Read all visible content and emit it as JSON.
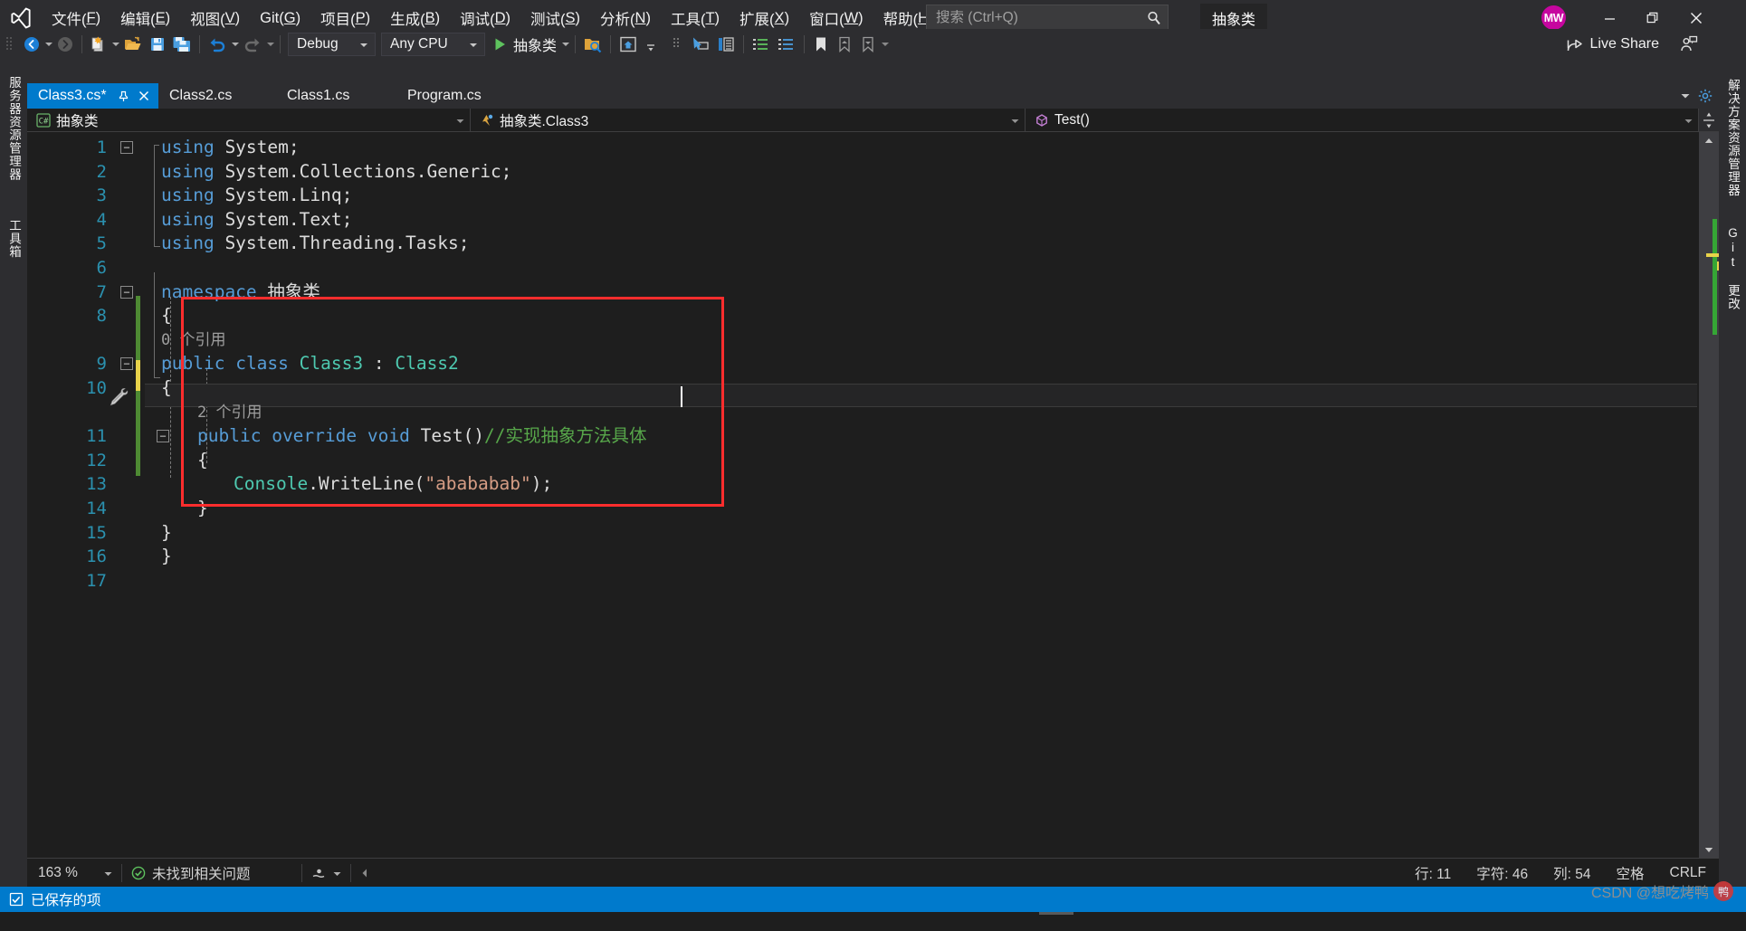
{
  "app": {
    "logo_icon": "visual-studio-logo",
    "solution_name": "抽象类"
  },
  "menubar": {
    "items": [
      {
        "label": "文件(F)",
        "name": "file"
      },
      {
        "label": "编辑(E)",
        "name": "edit"
      },
      {
        "label": "视图(V)",
        "name": "view"
      },
      {
        "label": "Git(G)",
        "name": "git"
      },
      {
        "label": "项目(P)",
        "name": "project"
      },
      {
        "label": "生成(B)",
        "name": "build"
      },
      {
        "label": "调试(D)",
        "name": "debug"
      },
      {
        "label": "测试(S)",
        "name": "test"
      },
      {
        "label": "分析(N)",
        "name": "analyze"
      },
      {
        "label": "工具(T)",
        "name": "tools"
      },
      {
        "label": "扩展(X)",
        "name": "extensions"
      },
      {
        "label": "窗口(W)",
        "name": "window"
      },
      {
        "label": "帮助(H)",
        "name": "help"
      }
    ]
  },
  "search": {
    "placeholder": "搜索 (Ctrl+Q)",
    "value": "",
    "icon": "search-icon"
  },
  "account": {
    "initials": "MW",
    "color": "#c6069f"
  },
  "window_controls": {
    "minimize": "minimize-icon",
    "maximize": "restore-icon",
    "close": "close-icon"
  },
  "toolbar": {
    "nav_back": "back-arrow-icon",
    "nav_forward": "forward-arrow-icon",
    "new_item": "new-file-icon",
    "open": "open-folder-icon",
    "save": "save-icon",
    "save_all": "save-all-icon",
    "undo": "undo-icon",
    "redo": "redo-icon",
    "config_label": "Debug",
    "platform_label": "Any CPU",
    "run_label": "抽象类",
    "run_icon": "play-icon",
    "search_solution_icon": "search-folder-icon",
    "live_share_label": "Live Share",
    "live_share_icon": "live-share-icon",
    "feedback_icon": "feedback-person-icon"
  },
  "left_dock": {
    "items": [
      {
        "label": "服务器资源管理器",
        "name": "server-explorer"
      },
      {
        "label": "工具箱",
        "name": "toolbox"
      }
    ]
  },
  "right_dock": {
    "items": [
      {
        "label": "解决方案资源管理器",
        "name": "solution-explorer"
      },
      {
        "label": "Git 更改",
        "name": "git-changes"
      }
    ]
  },
  "tabs": [
    {
      "label": "Class3.cs*",
      "active": true,
      "name": "class3"
    },
    {
      "label": "Class2.cs",
      "active": false,
      "name": "class2"
    },
    {
      "label": "Class1.cs",
      "active": false,
      "name": "class1"
    },
    {
      "label": "Program.cs",
      "active": false,
      "name": "program"
    }
  ],
  "tab_controls": {
    "pin_icon": "pin-icon",
    "close_icon": "close-icon",
    "dropdown_icon": "chevron-down-icon",
    "settings_icon": "gear-icon"
  },
  "breadcrumb": {
    "project": "抽象类",
    "project_icon": "csharp-file-icon",
    "type": "抽象类.Class3",
    "type_icon": "class-icon",
    "member": "Test()",
    "member_icon": "method-icon",
    "split_icon": "split-view-icon"
  },
  "code": {
    "lines": [
      {
        "n": "1",
        "indent": 0,
        "fold": "minus",
        "tokens": [
          {
            "t": "using",
            "c": "kw"
          },
          {
            "t": " System;",
            "c": "pln"
          }
        ]
      },
      {
        "n": "2",
        "indent": 0,
        "tokens": [
          {
            "t": "using",
            "c": "kw"
          },
          {
            "t": " System.Collections.Generic;",
            "c": "pln"
          }
        ]
      },
      {
        "n": "3",
        "indent": 0,
        "tokens": [
          {
            "t": "using",
            "c": "kw"
          },
          {
            "t": " System.Linq;",
            "c": "pln"
          }
        ]
      },
      {
        "n": "4",
        "indent": 0,
        "tokens": [
          {
            "t": "using",
            "c": "kw"
          },
          {
            "t": " System.Text;",
            "c": "pln"
          }
        ]
      },
      {
        "n": "5",
        "indent": 0,
        "tokens": [
          {
            "t": "using",
            "c": "kw"
          },
          {
            "t": " System.Threading.Tasks;",
            "c": "pln"
          }
        ]
      },
      {
        "n": "6",
        "indent": 0,
        "tokens": []
      },
      {
        "n": "7",
        "indent": 0,
        "fold": "minus",
        "tokens": [
          {
            "t": "namespace",
            "c": "kw"
          },
          {
            "t": " 抽象类",
            "c": "pln"
          }
        ]
      },
      {
        "n": "8",
        "indent": 0,
        "tokens": [
          {
            "t": "{",
            "c": "pln"
          }
        ]
      },
      {
        "n": "",
        "indent": 0,
        "reference": "0 个引用"
      },
      {
        "n": "9",
        "indent": 0,
        "fold": "minus",
        "tokens": [
          {
            "t": "public",
            "c": "kw"
          },
          {
            "t": " ",
            "c": "pln"
          },
          {
            "t": "class",
            "c": "kw"
          },
          {
            "t": " ",
            "c": "pln"
          },
          {
            "t": "Class3",
            "c": "type"
          },
          {
            "t": " : ",
            "c": "pln"
          },
          {
            "t": "Class2",
            "c": "type"
          }
        ]
      },
      {
        "n": "10",
        "indent": 0,
        "tokens": [
          {
            "t": "{",
            "c": "pln"
          }
        ]
      },
      {
        "n": "",
        "indent": 1,
        "reference": "2 个引用"
      },
      {
        "n": "11",
        "indent": 1,
        "fold": "minus",
        "current": true,
        "tokens": [
          {
            "t": "public",
            "c": "kw"
          },
          {
            "t": " ",
            "c": "pln"
          },
          {
            "t": "override",
            "c": "kw"
          },
          {
            "t": " ",
            "c": "pln"
          },
          {
            "t": "void",
            "c": "kw"
          },
          {
            "t": " ",
            "c": "pln"
          },
          {
            "t": "Test",
            "c": "mth"
          },
          {
            "t": "()",
            "c": "pln"
          },
          {
            "t": "//实现抽象方法具体",
            "c": "cmt"
          }
        ]
      },
      {
        "n": "12",
        "indent": 1,
        "tokens": [
          {
            "t": "{",
            "c": "pln"
          }
        ]
      },
      {
        "n": "13",
        "indent": 2,
        "tokens": [
          {
            "t": "Console",
            "c": "type"
          },
          {
            "t": ".WriteLine(",
            "c": "pln"
          },
          {
            "t": "\"abababab\"",
            "c": "str"
          },
          {
            "t": ");",
            "c": "pln"
          }
        ]
      },
      {
        "n": "14",
        "indent": 1,
        "tokens": [
          {
            "t": "}",
            "c": "pln"
          }
        ]
      },
      {
        "n": "15",
        "indent": 0,
        "tokens": [
          {
            "t": "}",
            "c": "pln"
          }
        ]
      },
      {
        "n": "16",
        "indent": 0,
        "tokens": [
          {
            "t": "}",
            "c": "pln"
          }
        ]
      },
      {
        "n": "17",
        "indent": 0,
        "tokens": []
      }
    ]
  },
  "editor_status": {
    "zoom": "163 %",
    "problems_icon": "check-circle-icon",
    "problems": "未找到相关问题",
    "selection_icon": "selection-icon",
    "line_label": "行: 11",
    "char_label": "字符: 46",
    "col_label": "列: 54",
    "spaces_label": "空格",
    "eol_label": "CRLF"
  },
  "app_status": {
    "icon": "save-check-icon",
    "message": "已保存的项"
  },
  "watermark": {
    "text": "CSDN @想吃烤鸭",
    "stamp": "鸭"
  }
}
